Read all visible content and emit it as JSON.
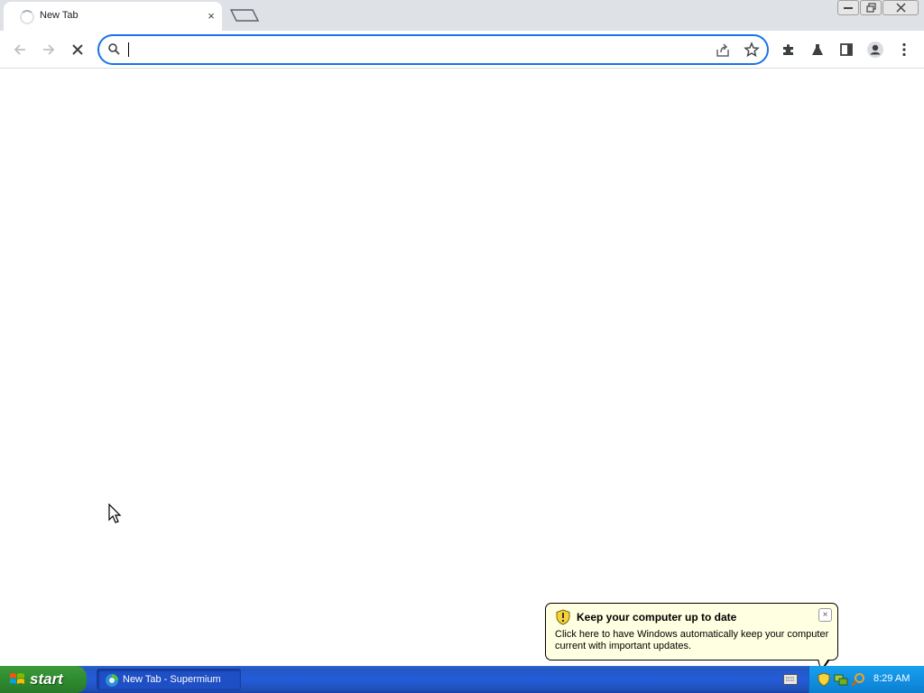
{
  "browser": {
    "tab": {
      "title": "New Tab",
      "close": "×"
    },
    "omnibox": {
      "value": ""
    }
  },
  "balloon": {
    "title": "Keep your computer up to date",
    "text": "Click here to have Windows automatically keep your computer current with important updates.",
    "close": "×"
  },
  "taskbar": {
    "start_label": "start",
    "task_label": "New Tab - Supermium",
    "clock": "8:29 AM"
  },
  "colors": {
    "accent": "#1a73e8",
    "taskbar_blue": "#245dda",
    "start_green": "#2f8b2f",
    "balloon_bg": "#ffffe1"
  },
  "icons": [
    "loading-spinner-icon",
    "new-tab-icon",
    "back-icon",
    "forward-icon",
    "stop-icon",
    "search-icon",
    "share-icon",
    "star-icon",
    "extensions-icon",
    "labs-icon",
    "side-panel-icon",
    "profile-icon",
    "menu-icon",
    "shield-icon",
    "windows-logo-icon",
    "browser-icon",
    "keyboard-icon",
    "network-icon",
    "search-tray-icon"
  ]
}
